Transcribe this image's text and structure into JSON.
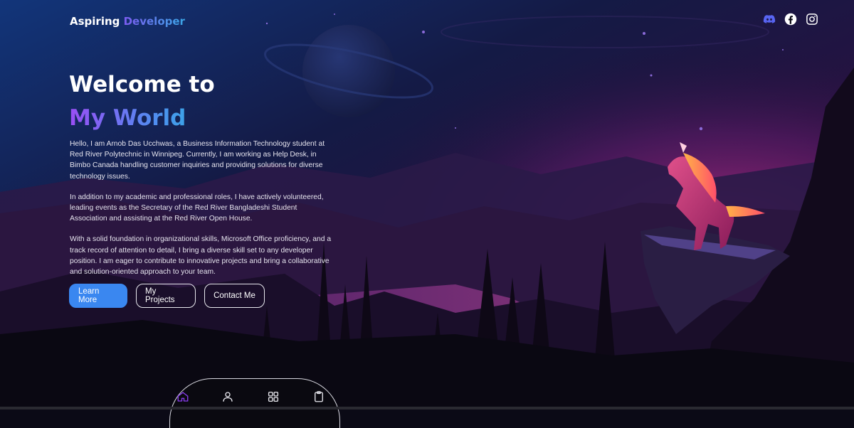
{
  "brand": {
    "name": "Aspiring",
    "accent": "Developer"
  },
  "socials": [
    {
      "icon": "discord-icon"
    },
    {
      "icon": "facebook-icon"
    },
    {
      "icon": "instagram-icon"
    }
  ],
  "hero": {
    "title_line1": "Welcome to",
    "title_line2": "My World",
    "paragraphs": [
      "Hello, I am Arnob Das Ucchwas, a Business Information Technology student at Red River Polytechnic in Winnipeg. Currently, I am working as Help Desk, in Bimbo Canada handling customer inquiries and providing solutions for diverse technology issues.",
      "In addition to my academic and professional roles, I have actively volunteered, leading events as the Secretary of the Red River Bangladeshi Student Association and assisting at the Red River Open House.",
      "With a solid foundation in organizational skills, Microsoft Office proficiency, and a track record of attention to detail, I bring a diverse skill set to any developer position. I am eager to contribute to innovative projects and bring a collaborative and solution-oriented approach to your team."
    ]
  },
  "buttons": {
    "learn_more": "Learn More",
    "projects": "My Projects",
    "contact": "Contact Me"
  },
  "bottom_nav": [
    {
      "icon": "home-icon",
      "active": true
    },
    {
      "icon": "user-icon",
      "active": false
    },
    {
      "icon": "grid-icon",
      "active": false
    },
    {
      "icon": "clipboard-icon",
      "active": false
    }
  ],
  "colors": {
    "accent_blue": "#3a87f0",
    "accent_purple": "#9a4ef5",
    "discord": "#5865f2",
    "active_nav": "#8a3cf0",
    "background": "#0b0a16"
  }
}
